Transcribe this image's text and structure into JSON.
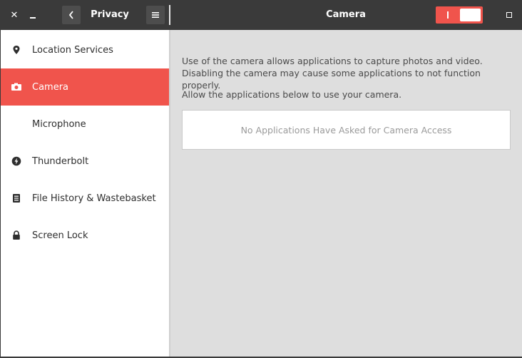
{
  "window": {
    "close_glyph": "✕",
    "sidebar_title": "Privacy",
    "main_title": "Camera",
    "camera_toggle": {
      "state": "on",
      "accent": "#f0544c"
    }
  },
  "sidebar": {
    "items": [
      {
        "label": "Location Services",
        "icon": "location-pin-icon",
        "active": false
      },
      {
        "label": "Camera",
        "icon": "camera-icon",
        "active": true
      },
      {
        "label": "Microphone",
        "icon": "",
        "active": false
      },
      {
        "label": "Thunderbolt",
        "icon": "thunderbolt-icon",
        "active": false
      },
      {
        "label": "File History & Wastebasket",
        "icon": "file-history-icon",
        "active": false
      },
      {
        "label": "Screen Lock",
        "icon": "lock-icon",
        "active": false
      }
    ]
  },
  "camera_panel": {
    "description": "Use of the camera allows applications to capture photos and video. Disabling the camera may cause some applications to not function properly.",
    "allow_label": "Allow the applications below to use your camera.",
    "empty_list_text": "No Applications Have Asked for Camera Access"
  },
  "colors": {
    "titlebar": "#3a3a3a",
    "accent": "#f0544c",
    "content_background": "#dedede"
  }
}
